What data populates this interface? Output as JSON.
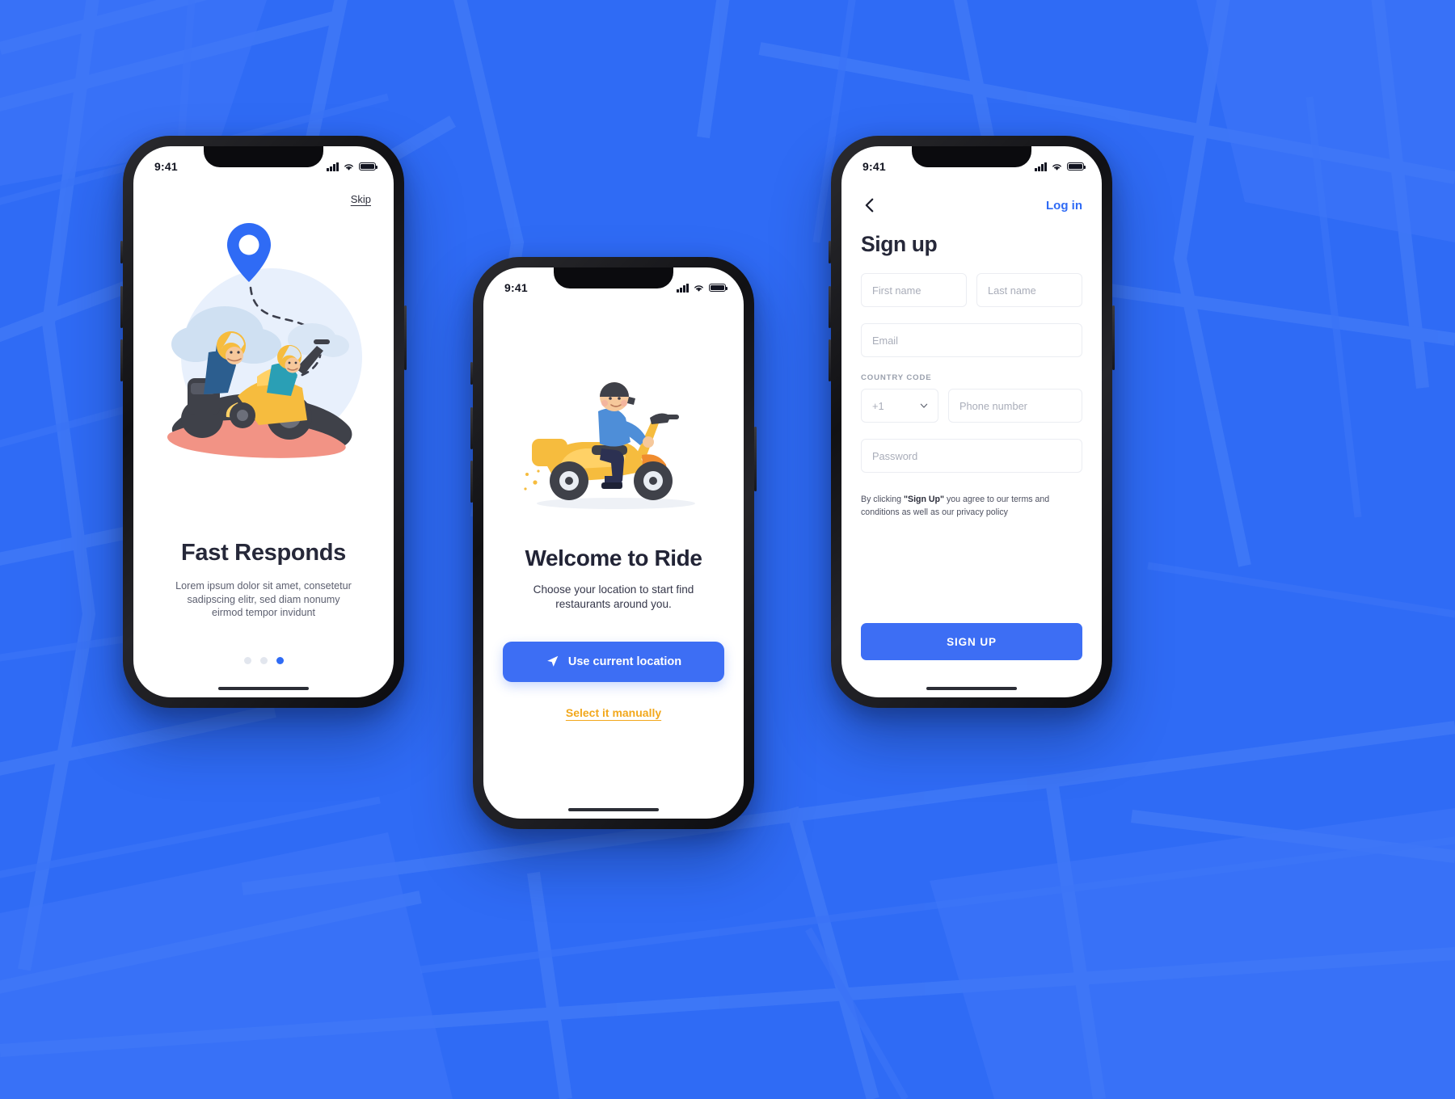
{
  "background": {
    "color": "#2f6bf5",
    "pattern": "map-street-lines"
  },
  "theme": {
    "blue": "#2f6bf5",
    "button_blue": "#3d6ef4",
    "amber": "#f2a81c",
    "dark": "#262839",
    "field_border": "#ebedf2"
  },
  "screen1": {
    "status": {
      "time": "9:41"
    },
    "skip_label": "Skip",
    "title": "Fast Responds",
    "body": "Lorem ipsum dolor sit amet, consetetur sadipscing elitr, sed diam nonumy eirmod tempor invidunt",
    "dots": {
      "count": 3,
      "active_index": 2
    },
    "illustration": "two-riders-on-scooter-with-map-pin"
  },
  "screen2": {
    "status": {
      "time": "9:41"
    },
    "title": "Welcome to Ride",
    "body": "Choose your location to start find restaurants around you.",
    "primary_button": "Use current location",
    "primary_button_icon": "navigation-arrow-icon",
    "manual_link": "Select it manually",
    "illustration": "delivery-rider-on-yellow-scooter"
  },
  "screen3": {
    "status": {
      "time": "9:41"
    },
    "back_icon": "chevron-left-icon",
    "login_link": "Log in",
    "title": "Sign up",
    "fields": {
      "first_name": "First name",
      "last_name": "Last name",
      "email": "Email",
      "country_code_label": "COUNTRY CODE",
      "country_code_value": "+1",
      "phone": "Phone number",
      "password": "Password"
    },
    "terms": {
      "prefix": "By clicking ",
      "emphasis": "\"Sign Up\"",
      "suffix": " you agree to our terms and conditions as well as our privacy policy"
    },
    "submit_button": "SIGN UP"
  }
}
